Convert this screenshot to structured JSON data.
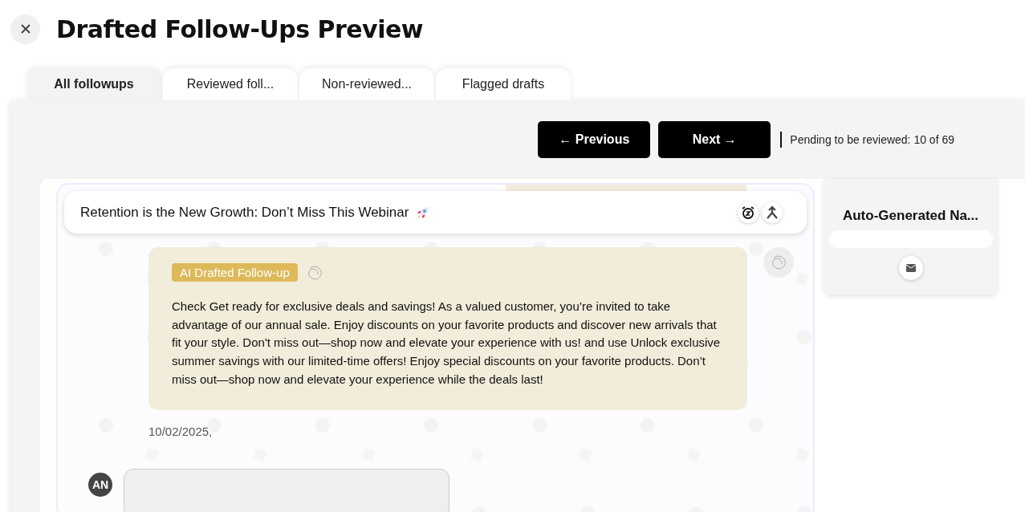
{
  "title": "Drafted Follow-Ups Preview",
  "tabs": [
    {
      "label": "All followups",
      "selected": true
    },
    {
      "label": "Reviewed foll...",
      "selected": false
    },
    {
      "label": "Non-reviewed...",
      "selected": false
    },
    {
      "label": "Flagged drafts",
      "selected": false
    }
  ],
  "nav": {
    "previous": "← Previous",
    "next": "Next →",
    "pending": "Pending to be reviewed: 10 of 69"
  },
  "conversation": {
    "subject": "Retention is the New Growth: Don’t Miss This Webinar",
    "draft": {
      "badge": "AI Drafted Follow-up",
      "body": "Check Get ready for exclusive deals and savings! As a valued customer, you’re invited to take advantage of our annual sale. Enjoy discounts on your favorite products and discover new arrivals that fit your style. Don't miss out—shop now and elevate your experience with us! and use Unlock exclusive summer savings with our limited-time offers! Enjoy special discounts on your favorite products. Don’t miss out—shop now and elevate your experience while the deals last!"
    },
    "date": "10/02/2025,",
    "next_avatar": "AN"
  },
  "contact": {
    "name": "Auto-Generated Na..."
  }
}
